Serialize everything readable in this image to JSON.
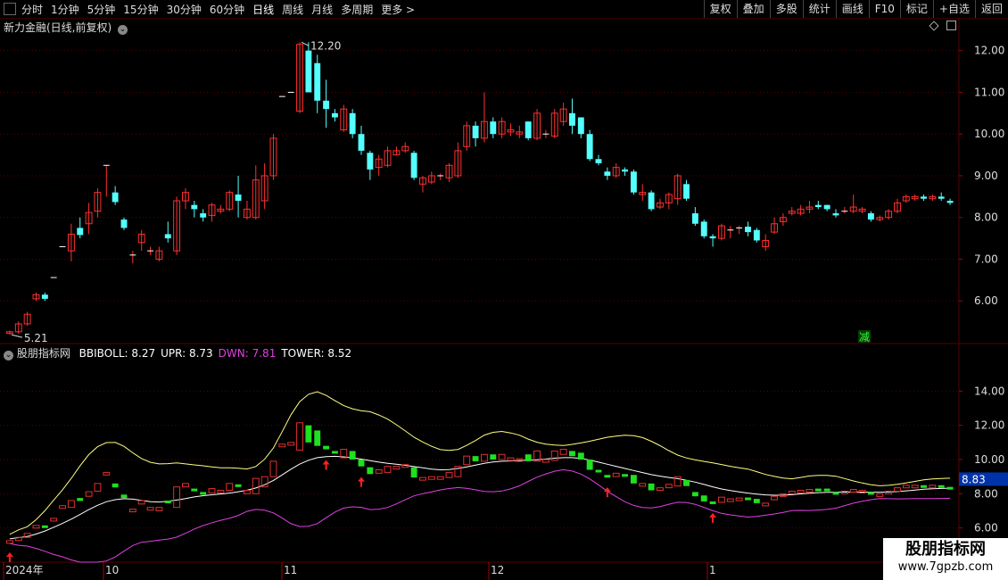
{
  "toolbar": {
    "periods": [
      "分时",
      "1分钟",
      "5分钟",
      "15分钟",
      "30分钟",
      "60分钟",
      "日线",
      "周线",
      "月线",
      "多周期",
      "更多 >"
    ],
    "active_period": "日线",
    "tools": [
      "复权",
      "叠加",
      "多股",
      "统计",
      "画线",
      "F10",
      "标记",
      "+自选",
      "返回"
    ]
  },
  "stock": {
    "title": "新力金融(日线,前复权)"
  },
  "indicator": {
    "name": "股朋指标网",
    "items": [
      {
        "label": "BBIBOLL: 8.27",
        "color": "#ffffff"
      },
      {
        "label": "UPR: 8.73",
        "color": "#ffffff"
      },
      {
        "label": "DWN: 7.81",
        "color": "#e040e0"
      },
      {
        "label": "TOWER: 8.52",
        "color": "#ffffff"
      }
    ],
    "current_value": "8.83"
  },
  "price_axis": {
    "ticks": [
      "12.00",
      "11.00",
      "10.00",
      "9.00",
      "8.00",
      "7.00",
      "6.00"
    ]
  },
  "ind_axis": {
    "ticks": [
      "14.00",
      "12.00",
      "10.00",
      "8.00",
      "6.00"
    ]
  },
  "annotations": {
    "high": "12.20",
    "low": "5.21",
    "marker": "减"
  },
  "time_axis": {
    "labels": [
      "2024年",
      "10",
      "11",
      "12",
      "1"
    ]
  },
  "watermark": {
    "line1": "股朋指标网",
    "line2": "www.7gpzb.com"
  },
  "colors": {
    "up": "#ff3030",
    "down": "#54ffff",
    "bull": "#e03030",
    "bear": "#20e020",
    "upper": "#ffff80",
    "mid": "#ffffff",
    "lower": "#e040e0",
    "grid": "#5a0000"
  },
  "chart_data": {
    "type": "candlestick",
    "series": [
      {
        "name": "price",
        "values": [
          [
            5.22,
            5.26,
            5.19,
            5.29
          ],
          [
            5.26,
            5.45,
            5.21,
            5.51
          ],
          [
            5.45,
            5.68,
            5.4,
            5.74
          ],
          [
            6.05,
            6.15,
            6.0,
            6.2
          ],
          [
            6.15,
            6.05,
            6.0,
            6.2
          ],
          [
            6.56,
            6.56,
            6.56,
            6.56
          ],
          [
            7.3,
            7.3,
            7.3,
            7.3
          ],
          [
            7.2,
            7.6,
            6.95,
            7.85
          ],
          [
            7.75,
            7.58,
            7.5,
            8.0
          ],
          [
            7.85,
            8.12,
            7.6,
            8.35
          ],
          [
            8.15,
            8.6,
            8.0,
            8.7
          ],
          [
            9.25,
            9.25,
            8.5,
            9.25
          ],
          [
            8.6,
            8.37,
            8.3,
            8.75
          ],
          [
            7.95,
            7.75,
            7.7,
            8.0
          ],
          [
            7.1,
            7.1,
            6.9,
            7.2
          ],
          [
            7.4,
            7.6,
            7.2,
            7.7
          ],
          [
            7.2,
            7.2,
            7.1,
            7.3
          ],
          [
            7.0,
            7.2,
            6.95,
            7.3
          ],
          [
            7.6,
            7.5,
            7.4,
            7.9
          ],
          [
            7.2,
            8.4,
            7.1,
            8.5
          ],
          [
            8.4,
            8.6,
            8.2,
            8.7
          ],
          [
            8.3,
            8.2,
            8.0,
            8.4
          ],
          [
            8.1,
            8.0,
            7.9,
            8.2
          ],
          [
            8.05,
            8.3,
            7.9,
            8.35
          ],
          [
            8.15,
            8.2,
            8.1,
            8.3
          ],
          [
            8.2,
            8.6,
            8.15,
            8.65
          ],
          [
            8.55,
            8.4,
            8.0,
            9.0
          ],
          [
            8.0,
            8.2,
            7.95,
            8.4
          ],
          [
            8.0,
            8.9,
            7.95,
            9.25
          ],
          [
            8.4,
            9.0,
            8.2,
            9.3
          ],
          [
            9.0,
            9.9,
            8.9,
            10.0
          ],
          [
            10.9,
            10.9,
            10.9,
            10.9
          ],
          [
            11.0,
            11.0,
            11.0,
            11.0
          ],
          [
            10.55,
            12.15,
            10.5,
            12.2
          ],
          [
            12.0,
            11.0,
            11.0,
            12.2
          ],
          [
            11.7,
            10.8,
            10.5,
            11.9
          ],
          [
            10.8,
            10.6,
            10.15,
            11.3
          ],
          [
            10.5,
            10.4,
            10.3,
            10.6
          ],
          [
            10.1,
            10.6,
            10.05,
            10.7
          ],
          [
            10.5,
            10.0,
            9.9,
            10.6
          ],
          [
            10.0,
            9.6,
            9.5,
            10.2
          ],
          [
            9.55,
            9.15,
            8.9,
            9.6
          ],
          [
            9.2,
            9.4,
            9.0,
            9.5
          ],
          [
            9.25,
            9.6,
            9.2,
            9.7
          ],
          [
            9.5,
            9.6,
            9.5,
            9.7
          ],
          [
            9.6,
            9.7,
            9.55,
            9.8
          ],
          [
            9.55,
            8.95,
            8.9,
            9.6
          ],
          [
            8.8,
            8.95,
            8.6,
            9.0
          ],
          [
            8.85,
            9.0,
            8.8,
            9.1
          ],
          [
            9.0,
            9.0,
            8.9,
            9.05
          ],
          [
            8.95,
            9.25,
            8.85,
            9.3
          ],
          [
            9.0,
            9.6,
            8.95,
            9.8
          ],
          [
            9.7,
            10.2,
            9.6,
            10.3
          ],
          [
            10.2,
            9.9,
            9.7,
            10.3
          ],
          [
            9.9,
            10.3,
            9.8,
            11.0
          ],
          [
            10.3,
            10.0,
            9.9,
            10.4
          ],
          [
            10.0,
            10.3,
            9.9,
            10.4
          ],
          [
            10.05,
            10.1,
            9.95,
            10.25
          ],
          [
            10.0,
            10.05,
            9.9,
            10.2
          ],
          [
            10.3,
            9.9,
            9.85,
            10.3
          ],
          [
            9.9,
            10.5,
            9.85,
            10.6
          ],
          [
            10.0,
            10.0,
            9.9,
            10.1
          ],
          [
            9.95,
            10.5,
            9.9,
            10.6
          ],
          [
            10.3,
            10.6,
            10.2,
            10.75
          ],
          [
            10.5,
            10.2,
            10.0,
            10.85
          ],
          [
            10.4,
            10.0,
            9.9,
            10.4
          ],
          [
            10.0,
            9.4,
            9.35,
            10.1
          ],
          [
            9.4,
            9.3,
            9.25,
            9.5
          ],
          [
            9.1,
            9.0,
            8.9,
            9.2
          ],
          [
            9.0,
            9.2,
            8.95,
            9.3
          ],
          [
            9.15,
            9.1,
            9.0,
            9.2
          ],
          [
            9.1,
            8.6,
            8.55,
            9.15
          ],
          [
            8.55,
            8.6,
            8.4,
            8.8
          ],
          [
            8.6,
            8.2,
            8.15,
            8.65
          ],
          [
            8.25,
            8.35,
            8.2,
            8.45
          ],
          [
            8.35,
            8.55,
            8.2,
            8.6
          ],
          [
            8.45,
            9.0,
            8.3,
            9.05
          ],
          [
            8.8,
            8.45,
            8.4,
            8.9
          ],
          [
            8.1,
            7.85,
            7.8,
            8.25
          ],
          [
            7.9,
            7.55,
            7.5,
            7.95
          ],
          [
            7.55,
            7.5,
            7.3,
            7.6
          ],
          [
            7.5,
            7.8,
            7.45,
            7.85
          ],
          [
            7.7,
            7.7,
            7.5,
            7.8
          ],
          [
            7.75,
            7.75,
            7.6,
            7.8
          ],
          [
            7.78,
            7.65,
            7.55,
            7.9
          ],
          [
            7.7,
            7.45,
            7.4,
            7.75
          ],
          [
            7.3,
            7.45,
            7.2,
            7.6
          ],
          [
            7.65,
            7.85,
            7.6,
            8.0
          ],
          [
            7.9,
            8.0,
            7.8,
            8.1
          ],
          [
            8.1,
            8.15,
            8.05,
            8.25
          ],
          [
            8.1,
            8.2,
            8.05,
            8.3
          ],
          [
            8.2,
            8.25,
            8.1,
            8.4
          ],
          [
            8.3,
            8.25,
            8.2,
            8.4
          ],
          [
            8.3,
            8.2,
            8.15,
            8.3
          ],
          [
            8.1,
            8.05,
            8.0,
            8.2
          ],
          [
            8.15,
            8.15,
            8.1,
            8.25
          ],
          [
            8.15,
            8.25,
            8.1,
            8.55
          ],
          [
            8.15,
            8.2,
            8.1,
            8.25
          ],
          [
            8.1,
            7.95,
            7.9,
            8.15
          ],
          [
            7.95,
            8.0,
            7.9,
            8.05
          ],
          [
            8.0,
            8.15,
            7.95,
            8.2
          ],
          [
            8.15,
            8.35,
            8.1,
            8.45
          ],
          [
            8.4,
            8.5,
            8.35,
            8.55
          ],
          [
            8.45,
            8.5,
            8.4,
            8.55
          ],
          [
            8.5,
            8.45,
            8.4,
            8.55
          ],
          [
            8.45,
            8.5,
            8.4,
            8.55
          ],
          [
            8.5,
            8.45,
            8.4,
            8.6
          ],
          [
            8.4,
            8.35,
            8.3,
            8.45
          ]
        ]
      }
    ],
    "value_format": "[open, close, low, high]",
    "ylim": [
      5.0,
      12.4
    ]
  }
}
